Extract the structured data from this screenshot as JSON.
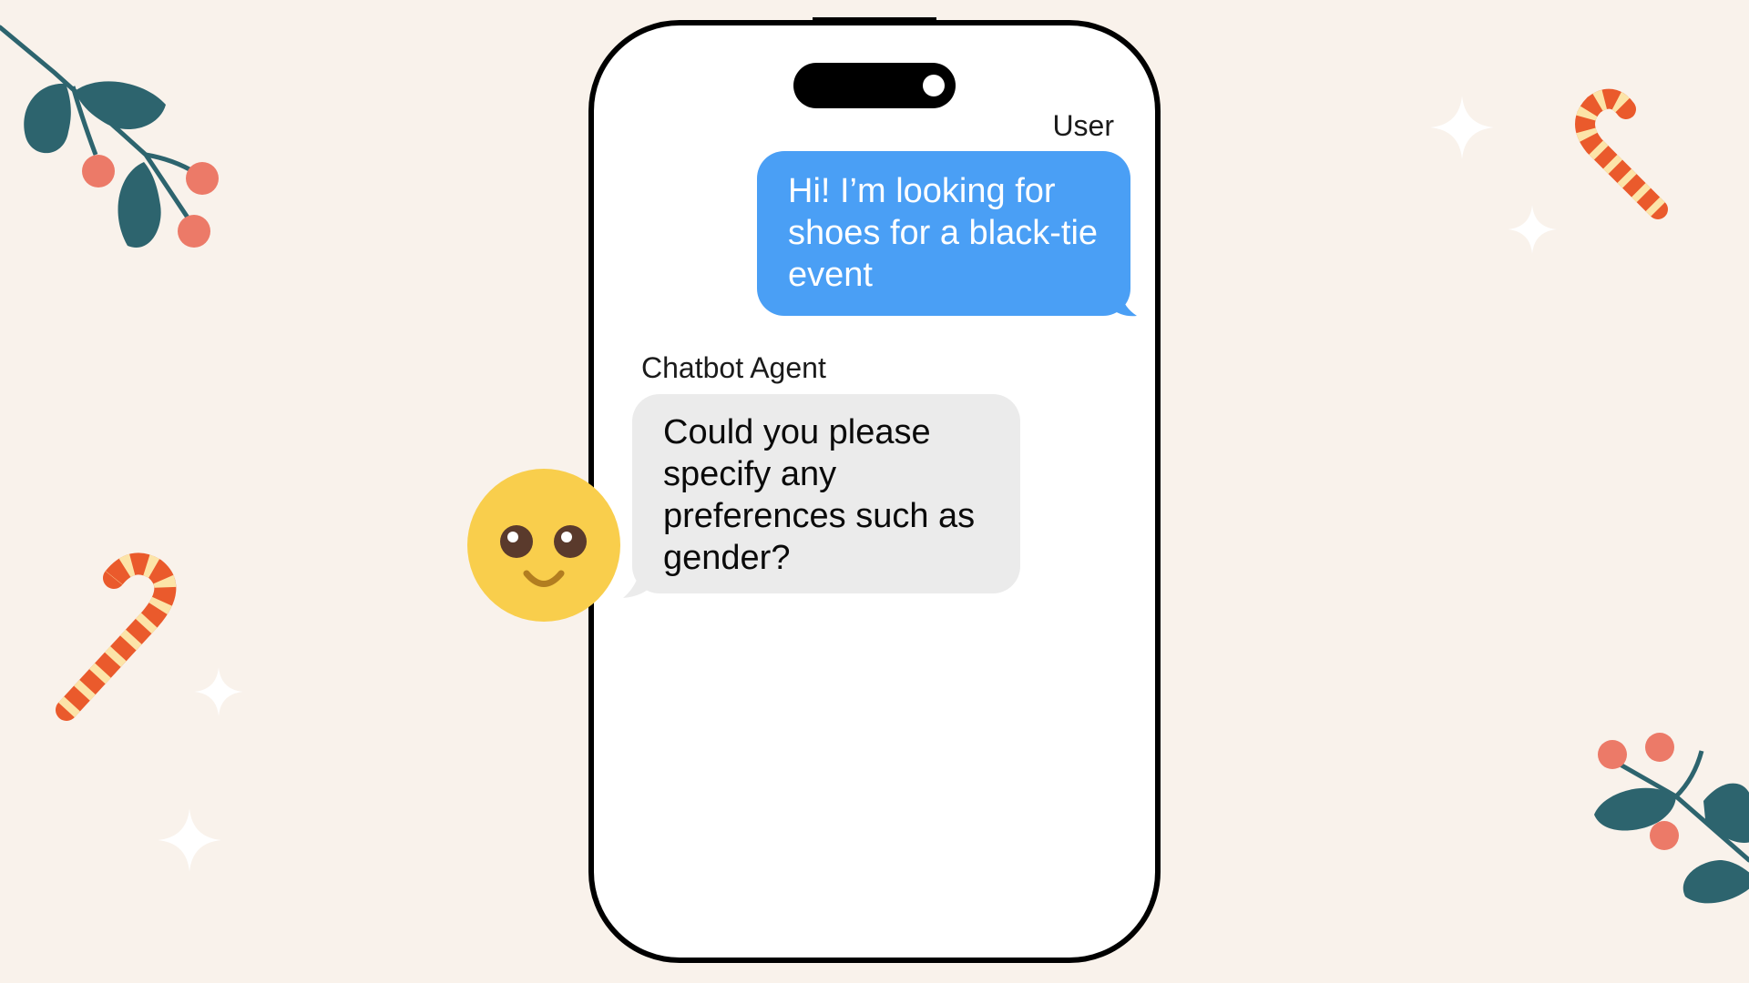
{
  "chat": {
    "user_label": "User",
    "user_message": "Hi! I’m looking for shoes for a black-tie event",
    "agent_label": "Chatbot Agent",
    "agent_message": "Could you please specify any preferences such as gender?"
  },
  "colors": {
    "background": "#f9f2eb",
    "user_bubble": "#4a9ff5",
    "agent_bubble": "#ebebeb",
    "avatar": "#f9ce4c",
    "leaf": "#2d646e",
    "berry": "#ec7a68",
    "candy_stripe": "#ea5a2c",
    "candy_cream": "#fce4a8"
  },
  "icons": {
    "avatar": "smiley-face-icon",
    "decorations": [
      "mistletoe-branch-icon",
      "candy-cane-icon",
      "sparkle-icon"
    ]
  }
}
